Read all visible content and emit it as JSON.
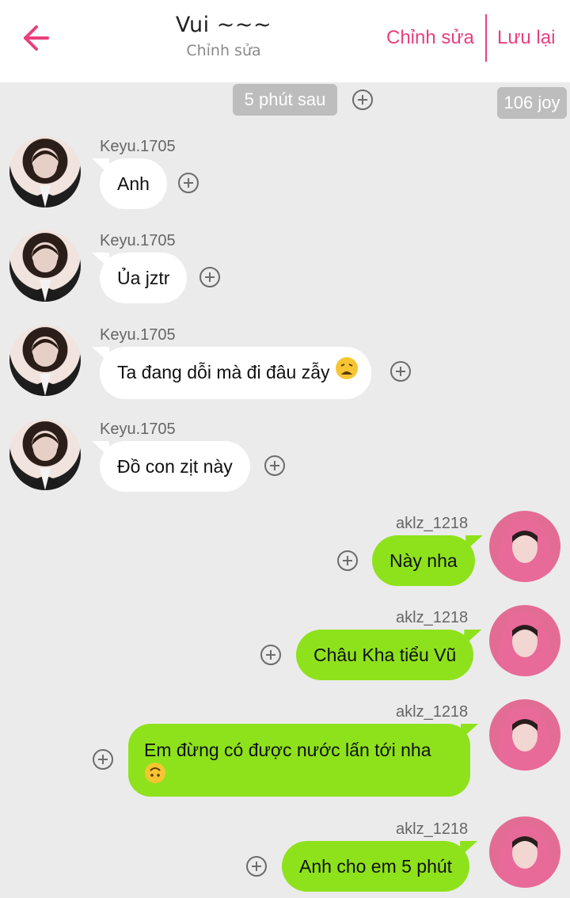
{
  "header": {
    "title": "Vui ~~~",
    "subtitle": "Chỉnh sửa",
    "edit_label": "Chỉnh sửa",
    "save_label": "Lưu lại",
    "accent": "#e8407f"
  },
  "time_pill": "5 phút sau",
  "joy_pill": "106 joy",
  "colors": {
    "sent_bubble": "#8ee21c",
    "received_bubble": "#ffffff",
    "background": "#ebebeb"
  },
  "messages": [
    {
      "side": "left",
      "sender": "Keyu.1705",
      "text": "Anh"
    },
    {
      "side": "left",
      "sender": "Keyu.1705",
      "text": "Ủa jztr"
    },
    {
      "side": "left",
      "sender": "Keyu.1705",
      "text": "Ta đang dỗi mà đi đâu zẫy",
      "emoji": "weary-face-emoji"
    },
    {
      "side": "left",
      "sender": "Keyu.1705",
      "text": "Đồ con zịt này"
    },
    {
      "side": "right",
      "sender": "aklz_1218",
      "text": "Này nha"
    },
    {
      "side": "right",
      "sender": "aklz_1218",
      "text": "Châu Kha tiểu Vũ"
    },
    {
      "side": "right",
      "sender": "aklz_1218",
      "text": "Em đừng có được nước lấn tới nha",
      "emoji": "upside-down-face-emoji"
    },
    {
      "side": "right",
      "sender": "aklz_1218",
      "text": "Anh cho em 5 phút"
    }
  ]
}
